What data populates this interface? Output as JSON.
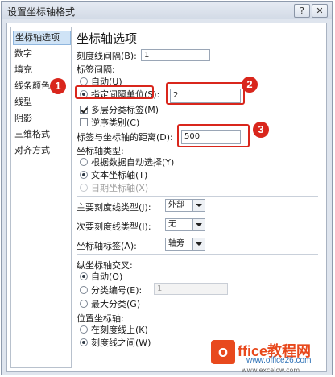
{
  "window": {
    "title": "设置坐标轴格式",
    "help": "?",
    "close": "✕"
  },
  "sidebar": {
    "items": [
      {
        "label": "坐标轴选项",
        "selected": true
      },
      {
        "label": "数字"
      },
      {
        "label": "填充"
      },
      {
        "label": "线条颜色"
      },
      {
        "label": "线型"
      },
      {
        "label": "阴影"
      },
      {
        "label": "三维格式"
      },
      {
        "label": "对齐方式"
      }
    ]
  },
  "panel": {
    "heading": "坐标轴选项",
    "tick_interval": {
      "label": "刻度线间隔(B):",
      "value": "1"
    },
    "label_interval": {
      "group_label": "标签间隔:",
      "auto": "自动(U)",
      "specify": "指定间隔单位(S):",
      "specify_value": "2"
    },
    "multilevel": "多层分类标签(M)",
    "reverse": "逆序类别(C)",
    "label_distance": {
      "label": "标签与坐标轴的距离(D):",
      "value": "500"
    },
    "axis_type": {
      "group_label": "坐标轴类型:",
      "auto": "根据数据自动选择(Y)",
      "text": "文本坐标轴(T)",
      "date": "日期坐标轴(X)"
    },
    "major_tick": {
      "label": "主要刻度线类型(J):",
      "value": "外部"
    },
    "minor_tick": {
      "label": "次要刻度线类型(I):",
      "value": "无"
    },
    "axis_labels": {
      "label": "坐标轴标签(A):",
      "value": "轴旁"
    },
    "cross": {
      "group_label": "纵坐标轴交叉:",
      "auto": "自动(O)",
      "category_number": "分类编号(E):",
      "category_value": "1",
      "max_category": "最大分类(G)"
    },
    "position": {
      "group_label": "位置坐标轴:",
      "on_tick": "在刻度线上(K)",
      "between_tick": "刻度线之间(W)"
    }
  },
  "callouts": [
    "1",
    "2",
    "3"
  ],
  "watermark": {
    "logo": "o",
    "brand": "ffice教程网",
    "site": "www.office26.com",
    "url": "www.excelcw.com"
  },
  "colors": {
    "accent": "#d9261c",
    "selection": "#cfe3f6",
    "frame": "#dfe5ee"
  }
}
